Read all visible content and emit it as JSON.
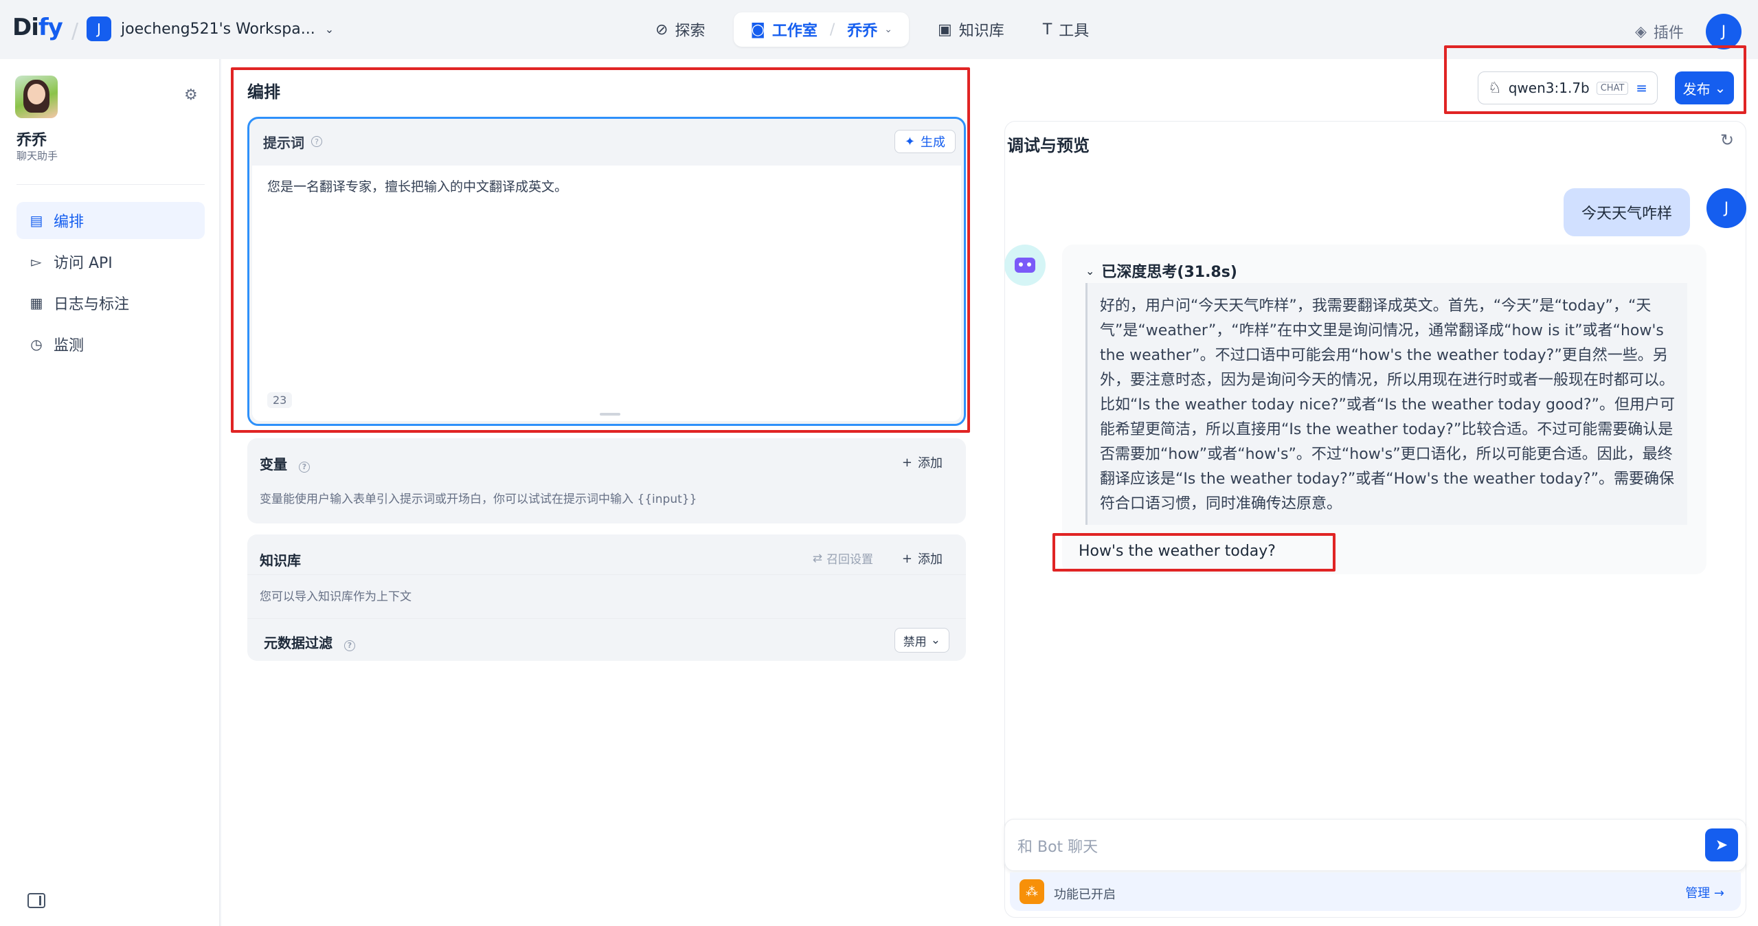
{
  "brand": {
    "logo_text_1": "Di",
    "logo_text_2": "fy"
  },
  "workspace": {
    "badge": "J",
    "name": "joecheng521's Workspa...",
    "chevron": "⌄"
  },
  "nav": {
    "explore": {
      "label": "探索",
      "icon": "compass-icon"
    },
    "studio": {
      "label": "工作室",
      "app": "乔乔",
      "icon": "robot-icon"
    },
    "knowledge": {
      "label": "知识库",
      "icon": "book-icon"
    },
    "tools": {
      "label": "工具",
      "icon": "hammer-icon"
    }
  },
  "topright": {
    "plugins": "插件",
    "avatar": "J"
  },
  "app": {
    "name": "乔乔",
    "type": "聊天助手"
  },
  "sidebar": {
    "items": [
      {
        "label": "编排",
        "icon": "layout-icon",
        "active": true
      },
      {
        "label": "访问 API",
        "icon": "terminal-icon",
        "active": false
      },
      {
        "label": "日志与标注",
        "icon": "file-text-icon",
        "active": false
      },
      {
        "label": "监测",
        "icon": "gauge-icon",
        "active": false
      }
    ]
  },
  "editor": {
    "title": "编排",
    "prompt": {
      "label": "提示词",
      "generate": "生成",
      "text": "您是一名翻译专家，擅长把输入的中文翻译成英文。",
      "char_count": "23"
    },
    "variables": {
      "title": "变量",
      "add": "添加",
      "desc": "变量能使用户输入表单引入提示词或开场白，你可以试试在提示词中输入 {{input}}"
    },
    "knowledge": {
      "title": "知识库",
      "recall": "召回设置",
      "add": "添加",
      "desc": "您可以导入知识库作为上下文",
      "meta_title": "元数据过滤",
      "meta_value": "禁用"
    }
  },
  "model": {
    "name": "qwen3:1.7b",
    "tag": "CHAT",
    "publish": "发布"
  },
  "debug": {
    "title": "调试与预览",
    "user_message": "今天天气咋样",
    "user_avatar": "J",
    "thinking_label": "已深度思考(31.8s)",
    "thinking_text": "好的，用户问“今天天气咋样”，我需要翻译成英文。首先，“今天”是“today”，“天气”是“weather”，“咋样”在中文里是询问情况，通常翻译成“how is it”或者“how's the weather”。不过口语中可能会用“how's the weather today?”更自然一些。另外，要注意时态，因为是询问今天的情况，所以用现在进行时或者一般现在时都可以。比如“Is the weather today nice?”或者“Is the weather today good?”。但用户可能希望更简洁，所以直接用“Is the weather today?”比较合适。不过可能需要确认是否需要加“how”或者“how's”。不过“how's”更口语化，所以可能更合适。因此，最终翻译应该是“Is the weather today?”或者“How's the weather today?”。需要确保符合口语习惯，同时准确传达原意。",
    "answer": "How's the weather today?",
    "input_placeholder": "和 Bot 聊天",
    "feature_label": "功能已开启",
    "manage": "管理 →"
  },
  "colors": {
    "accent": "#155eef",
    "highlight": "#e02424",
    "user_bubble": "#d1e0ff"
  }
}
